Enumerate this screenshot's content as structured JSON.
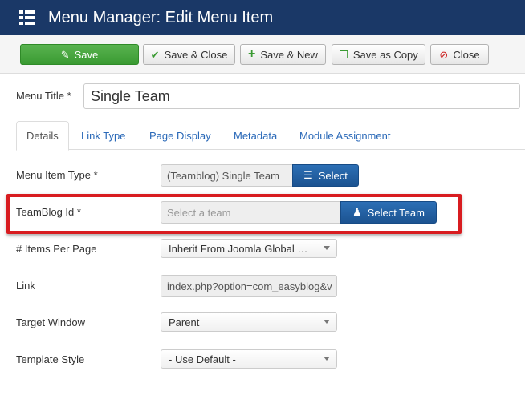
{
  "header": {
    "title": "Menu Manager: Edit Menu Item",
    "icon": "list-icon"
  },
  "toolbar": {
    "save_label": "Save",
    "save_close_label": "Save & Close",
    "save_new_label": "Save & New",
    "save_copy_label": "Save as Copy",
    "close_label": "Close"
  },
  "menu_title": {
    "label": "Menu Title *",
    "value": "Single Team"
  },
  "tabs": [
    {
      "label": "Details"
    },
    {
      "label": "Link Type"
    },
    {
      "label": "Page Display"
    },
    {
      "label": "Metadata"
    },
    {
      "label": "Module Assignment"
    }
  ],
  "form": {
    "menu_item_type": {
      "label": "Menu Item Type *",
      "value": "(Teamblog) Single Team",
      "button": "Select"
    },
    "teamblog_id": {
      "label": "TeamBlog Id *",
      "placeholder": "Select a team",
      "button": "Select Team"
    },
    "items_per_page": {
      "label": "# Items Per Page",
      "value": "Inherit From Joomla Global C..."
    },
    "link": {
      "label": "Link",
      "value": "index.php?option=com_easyblog&v"
    },
    "target_window": {
      "label": "Target Window",
      "value": "Parent"
    },
    "template_style": {
      "label": "Template Style",
      "value": "- Use Default -"
    }
  },
  "colors": {
    "header_bg": "#1a3867",
    "save_green": "#46a546",
    "primary_blue": "#2c6fb5",
    "highlight_red": "#d81c20",
    "link_blue": "#2a69b8"
  }
}
